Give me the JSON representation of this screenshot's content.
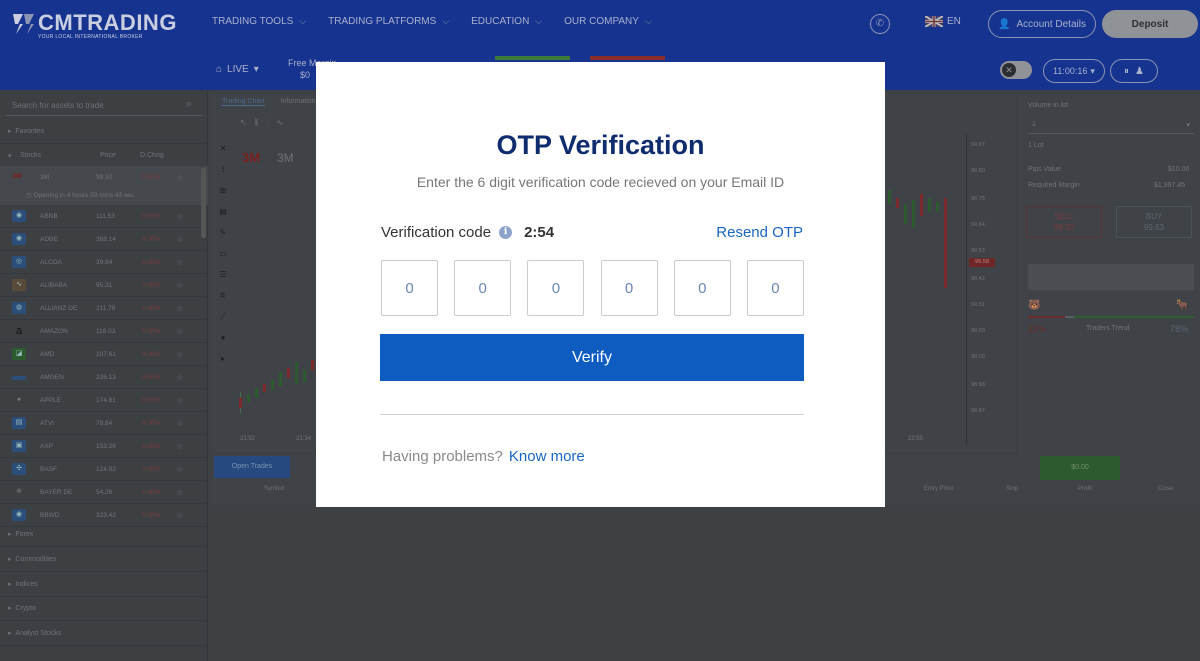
{
  "header": {
    "brand": "CMTRADING",
    "tagline": "YOUR LOCAL INTERNATIONAL BROKER",
    "nav": [
      {
        "label": "TRADING TOOLS"
      },
      {
        "label": "TRADING PLATFORMS"
      },
      {
        "label": "EDUCATION"
      },
      {
        "label": "OUR COMPANY"
      }
    ],
    "language": "EN",
    "account_label": "Account Details",
    "deposit_label": "Deposit"
  },
  "subbar": {
    "mode": "LIVE",
    "free_margin_label": "Free Margin",
    "free_margin_value": "$0",
    "clock": "11:00:16"
  },
  "sidebar": {
    "search_placeholder": "Search for assets to trade",
    "favorites": "Favorites",
    "stocks": "Stocks",
    "col_price": "Price",
    "col_change": "D.Chng",
    "opening_note": "Opening in 4 hours 59 mins 43 sec",
    "rows": [
      {
        "name": "3M",
        "price": "99.30",
        "change": "0.00%"
      },
      {
        "name": "ABNB",
        "price": "111.53",
        "change": "0.00%"
      },
      {
        "name": "ADBE",
        "price": "368.14",
        "change": "0.00%"
      },
      {
        "name": "ALCOA",
        "price": "39.84",
        "change": "0.00%"
      },
      {
        "name": "ALIBABA",
        "price": "95.31",
        "change": "0.00%"
      },
      {
        "name": "ALLIANZ DE",
        "price": "211.78",
        "change": "0.00%"
      },
      {
        "name": "AMAZON",
        "price": "118.03",
        "change": "0.00%"
      },
      {
        "name": "AMD",
        "price": "107.61",
        "change": "0.00%"
      },
      {
        "name": "AMGEN",
        "price": "226.13",
        "change": "0.00%"
      },
      {
        "name": "APPLE",
        "price": "174.81",
        "change": "0.00%"
      },
      {
        "name": "ATVI",
        "price": "78.84",
        "change": "0.00%"
      },
      {
        "name": "AXP",
        "price": "153.28",
        "change": "0.00%"
      },
      {
        "name": "BASF",
        "price": "124.82",
        "change": "0.00%"
      },
      {
        "name": "BAYER DE",
        "price": "54.26",
        "change": "0.00%"
      },
      {
        "name": "BBWD",
        "price": "323.42",
        "change": "0.00%"
      }
    ],
    "categories": [
      "Forex",
      "Commodities",
      "Indices",
      "Crypto",
      "Analyst Stocks"
    ]
  },
  "chart": {
    "tabs": [
      "Trading Chart",
      "Information"
    ],
    "symbol": "3M",
    "price_ticks": [
      "99.97",
      "99.80",
      "99.75",
      "99.64",
      "99.53",
      "99.42",
      "99.31",
      "99.20",
      "99.09",
      "98.98",
      "98.87"
    ],
    "price_tag": "99.58",
    "time_ticks": [
      "21:52",
      "21:34",
      "22:55"
    ]
  },
  "panel": {
    "volume_label": "Volume in lot",
    "volume_value": "1",
    "lot_label": "1 Lot",
    "pips_label": "Pips Value",
    "pips_value": "$10.00",
    "margin_label": "Required Margin",
    "margin_value": "$1,997.45",
    "sell_label": "SELL",
    "sell_price": "99.50",
    "buy_label": "BUY",
    "buy_price": "99.63",
    "sentiment_sell": "22%",
    "sentiment_label": "Traders Trend",
    "sentiment_buy": "78%",
    "sentiment_sell_fraction": 0.22,
    "sentiment_buy_fraction": 0.78
  },
  "bottom": {
    "open_trades": "Open Trades",
    "balance": "$0.00",
    "columns": [
      "Symbol",
      "Entry Price",
      "Stop",
      "Profit",
      "Close"
    ]
  },
  "modal": {
    "title": "OTP Verification",
    "subtitle": "Enter the 6 digit verification code recieved on your Email ID",
    "code_label": "Verification code",
    "timer": "2:54",
    "resend": "Resend OTP",
    "digits": [
      "0",
      "0",
      "0",
      "0",
      "0",
      "0"
    ],
    "verify": "Verify",
    "help_text": "Having problems?",
    "help_link": "Know more"
  }
}
